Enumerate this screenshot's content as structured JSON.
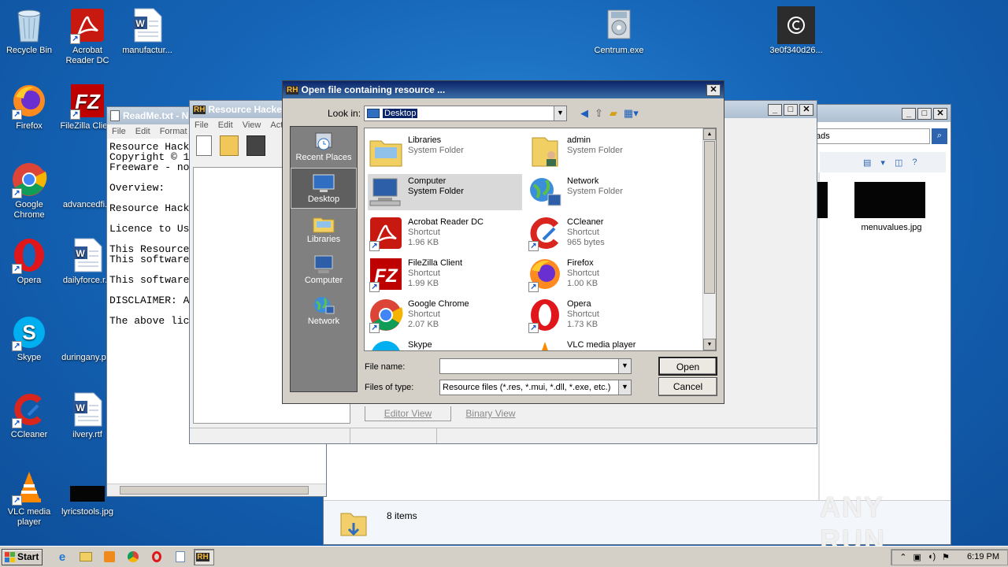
{
  "desktop_icons": [
    {
      "label": "Recycle Bin",
      "icon": "recycle-bin-icon"
    },
    {
      "label": "Acrobat Reader DC",
      "icon": "acrobat-icon"
    },
    {
      "label": "manufactur...",
      "icon": "word-doc-icon"
    },
    {
      "label": "Centrum.exe",
      "icon": "installer-icon"
    },
    {
      "label": "3e0f340d26...",
      "icon": "ccleaner-exe-icon"
    },
    {
      "label": "Firefox",
      "icon": "firefox-icon"
    },
    {
      "label": "FileZilla Client",
      "icon": "filezilla-icon"
    },
    {
      "label": "Google Chrome",
      "icon": "chrome-icon"
    },
    {
      "label": "advancedfi...",
      "icon": "file-icon"
    },
    {
      "label": "Opera",
      "icon": "opera-icon"
    },
    {
      "label": "dailyforce.r...",
      "icon": "word-doc-icon"
    },
    {
      "label": "Skype",
      "icon": "skype-icon"
    },
    {
      "label": "duringany.p...",
      "icon": "file-icon"
    },
    {
      "label": "CCleaner",
      "icon": "ccleaner-icon"
    },
    {
      "label": "ilvery.rtf",
      "icon": "word-doc-icon"
    },
    {
      "label": "VLC media player",
      "icon": "vlc-icon"
    },
    {
      "label": "lyricstools.jpg",
      "icon": "image-icon"
    }
  ],
  "notepad": {
    "title": "ReadMe.txt - N",
    "menu": [
      "File",
      "Edit",
      "Format"
    ],
    "lines": [
      "Resource Hack",
      "Copyright © 1",
      "Freeware - no",
      "",
      "Overview:",
      "",
      "Resource Hack",
      "",
      "Licence to Us",
      "",
      "This Resource",
      "This software",
      "",
      "This software",
      "",
      "DISCLAIMER: A",
      "",
      "The above lic"
    ]
  },
  "resource_hacker": {
    "title": "Resource Hacker",
    "menu": [
      "File",
      "Edit",
      "View",
      "Act"
    ],
    "tabs": [
      "Editor View",
      "Binary View"
    ]
  },
  "explorer": {
    "address_fragment": "ads",
    "file_label": "menuvalues.jpg",
    "status_items": "8 items"
  },
  "dialog": {
    "title": "Open file containing resource ...",
    "look_in_label": "Look in:",
    "look_in_value": "Desktop",
    "places": [
      {
        "label": "Recent Places",
        "icon": "recent-places-icon"
      },
      {
        "label": "Desktop",
        "icon": "desktop-icon",
        "selected": true
      },
      {
        "label": "Libraries",
        "icon": "libraries-icon"
      },
      {
        "label": "Computer",
        "icon": "computer-icon"
      },
      {
        "label": "Network",
        "icon": "network-icon"
      }
    ],
    "files": [
      {
        "name": "Libraries",
        "line2": "System Folder",
        "line3": "",
        "icon": "libraries-icon"
      },
      {
        "name": "admin",
        "line2": "System Folder",
        "line3": "",
        "icon": "user-folder-icon"
      },
      {
        "name": "Computer",
        "line2": "System Folder",
        "line3": "",
        "icon": "computer-icon",
        "selected": true
      },
      {
        "name": "Network",
        "line2": "System Folder",
        "line3": "",
        "icon": "network-icon"
      },
      {
        "name": "Acrobat Reader DC",
        "line2": "Shortcut",
        "line3": "1.96 KB",
        "icon": "acrobat-icon"
      },
      {
        "name": "CCleaner",
        "line2": "Shortcut",
        "line3": "965 bytes",
        "icon": "ccleaner-icon"
      },
      {
        "name": "FileZilla Client",
        "line2": "Shortcut",
        "line3": "1.99 KB",
        "icon": "filezilla-icon"
      },
      {
        "name": "Firefox",
        "line2": "Shortcut",
        "line3": "1.00 KB",
        "icon": "firefox-icon"
      },
      {
        "name": "Google Chrome",
        "line2": "Shortcut",
        "line3": "2.07 KB",
        "icon": "chrome-icon"
      },
      {
        "name": "Opera",
        "line2": "Shortcut",
        "line3": "1.73 KB",
        "icon": "opera-icon"
      },
      {
        "name": "Skype",
        "line2": "",
        "line3": "",
        "icon": "skype-icon"
      },
      {
        "name": "VLC media player",
        "line2": "",
        "line3": "",
        "icon": "vlc-icon"
      }
    ],
    "file_name_label": "File name:",
    "file_name_value": "",
    "files_of_type_label": "Files of type:",
    "files_of_type_value": "Resource files (*.res, *.mui, *.dll, *.exe, etc.)",
    "open_label": "Open",
    "cancel_label": "Cancel"
  },
  "taskbar": {
    "start_label": "Start",
    "clock": "6:19 PM"
  },
  "watermark": "ANY RUN",
  "colors": {
    "desktop": "#1565b8",
    "dialog_title": "#0a246a",
    "selection": "#0a246a"
  }
}
